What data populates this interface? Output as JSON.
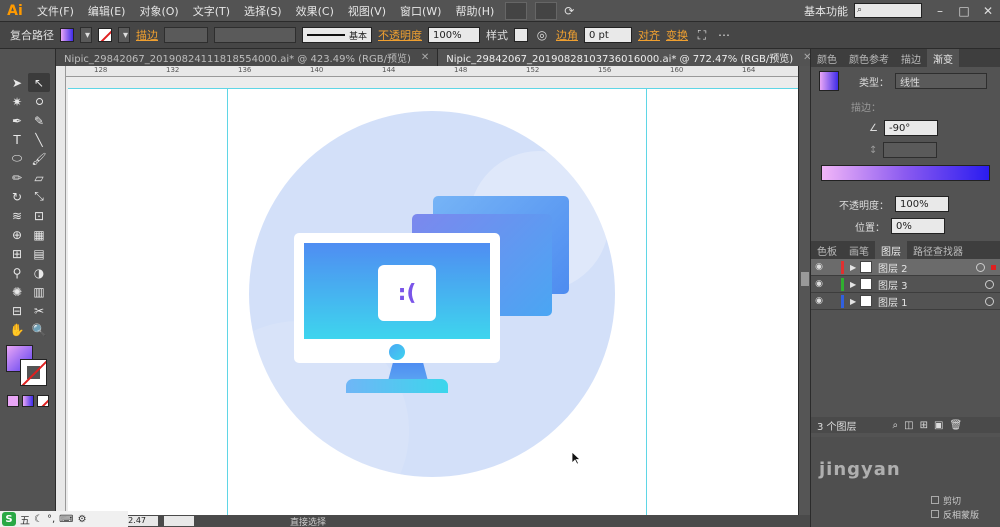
{
  "app": {
    "logo": "Ai"
  },
  "menu": [
    "文件(F)",
    "编辑(E)",
    "对象(O)",
    "文字(T)",
    "选择(S)",
    "效果(C)",
    "视图(V)",
    "窗口(W)",
    "帮助(H)"
  ],
  "workspace": "基本功能",
  "control": {
    "object_type": "复合路径",
    "stroke_link": "描边",
    "stroke_style": "基本",
    "opacity_link": "不透明度",
    "opacity_value": "100%",
    "style_label": "样式",
    "corner_link": "边角",
    "corner_value": "0 pt",
    "align_link": "对齐",
    "transform_link": "变换"
  },
  "tabs": [
    {
      "label": "Nipic_29842067_20190824111818554000.ai* @ 423.49% (RGB/预览)",
      "active": false
    },
    {
      "label": "Nipic_29842067_20190828103736016000.ai* @ 772.47% (RGB/预览)",
      "active": true
    }
  ],
  "rulers": [
    "128",
    "132",
    "136",
    "140",
    "144",
    "148",
    "152",
    "156",
    "160",
    "164"
  ],
  "canvas": {
    "face_text": ":(",
    "colors": {
      "circle": "#d3e0f9",
      "screen_top": "#4f8df2",
      "screen_bottom": "#3ed5ee",
      "accent": "#7a55e8"
    }
  },
  "status": {
    "zoom": "772.47",
    "tool": "直接选择"
  },
  "panels": {
    "top_tabs": [
      "颜色",
      "颜色参考",
      "描边",
      "渐变"
    ],
    "type_label": "类型：",
    "type_value": "线性",
    "stroke_label": "描边：",
    "angle_value": "-90°",
    "opacity_label": "不透明度：",
    "opacity_value": "100%",
    "location_label": "位置：",
    "location_value": "0%",
    "mid_tabs": [
      "色板",
      "画笔",
      "图层",
      "路径查找器"
    ],
    "layers": [
      {
        "name": "图层 2",
        "color": "#e03030",
        "selected": true
      },
      {
        "name": "图层 3",
        "color": "#30b030",
        "selected": false
      },
      {
        "name": "图层 1",
        "color": "#3060e0",
        "selected": false
      }
    ],
    "layer_count": "3 个图层",
    "lower_options": [
      "剪切",
      "反相蒙版"
    ],
    "watermark": "jingyan"
  },
  "ime": {
    "brand": "S",
    "label": "五"
  }
}
